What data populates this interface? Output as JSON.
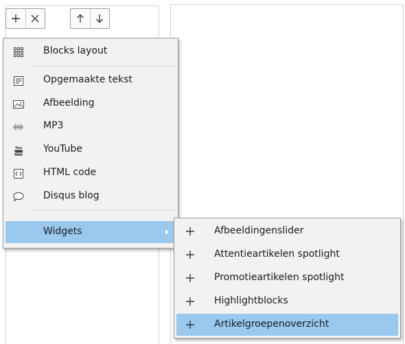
{
  "toolbar": {
    "add": "plus-icon",
    "remove": "close-icon",
    "move_up": "arrow-up-icon",
    "move_down": "arrow-down-icon"
  },
  "menu": {
    "items": [
      {
        "label": "Blocks layout",
        "icon": "grid-icon"
      },
      {
        "label": "Opgemaakte tekst",
        "icon": "formatted-text-icon"
      },
      {
        "label": "Afbeelding",
        "icon": "image-icon"
      },
      {
        "label": "MP3",
        "icon": "audio-wave-icon"
      },
      {
        "label": "YouTube",
        "icon": "youtube-icon"
      },
      {
        "label": "HTML code",
        "icon": "html-code-icon"
      },
      {
        "label": "Disqus blog",
        "icon": "speech-bubble-icon"
      },
      {
        "label": "Widgets",
        "icon": "submenu-arrow-icon"
      }
    ]
  },
  "submenu": {
    "items": [
      {
        "label": "Afbeeldingenslider"
      },
      {
        "label": "Attentieartikelen spotlight"
      },
      {
        "label": "Promotieartikelen spotlight"
      },
      {
        "label": "Highlightblocks"
      },
      {
        "label": "Artikelgroepenoverzicht"
      }
    ]
  },
  "colors": {
    "highlight": "#99c9ef",
    "menu_bg": "#f2f2f2",
    "border": "#9a9a9a"
  }
}
